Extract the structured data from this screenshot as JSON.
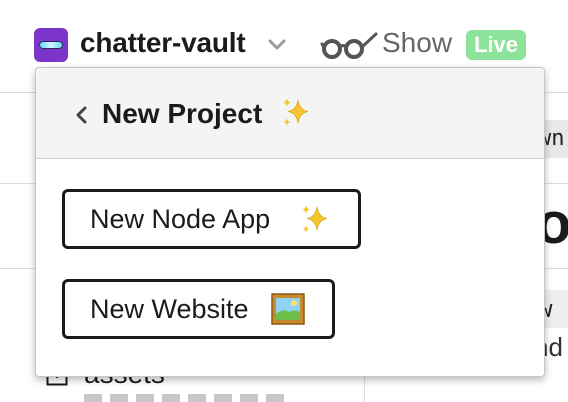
{
  "header": {
    "project_name": "chatter-vault",
    "show_label": "Show",
    "live_badge": "Live"
  },
  "background": {
    "tag_text": "wn",
    "heading_fragment": "or",
    "code_fragment": "w",
    "text_fragment": "nd",
    "folder_label": "assets"
  },
  "popover": {
    "title": "New Project",
    "title_icon": "sparkles-icon",
    "back_icon": "chevron-left-icon",
    "options": [
      {
        "label": "New Node App",
        "icon": "sparkles-icon"
      },
      {
        "label": "New Website",
        "icon": "framed-picture-icon"
      }
    ]
  },
  "colors": {
    "avatar": "#7b36c9",
    "live_badge": "#8ee39a",
    "text": "#1b1b1b",
    "muted": "#666666",
    "sparkle": "#f6c532"
  }
}
